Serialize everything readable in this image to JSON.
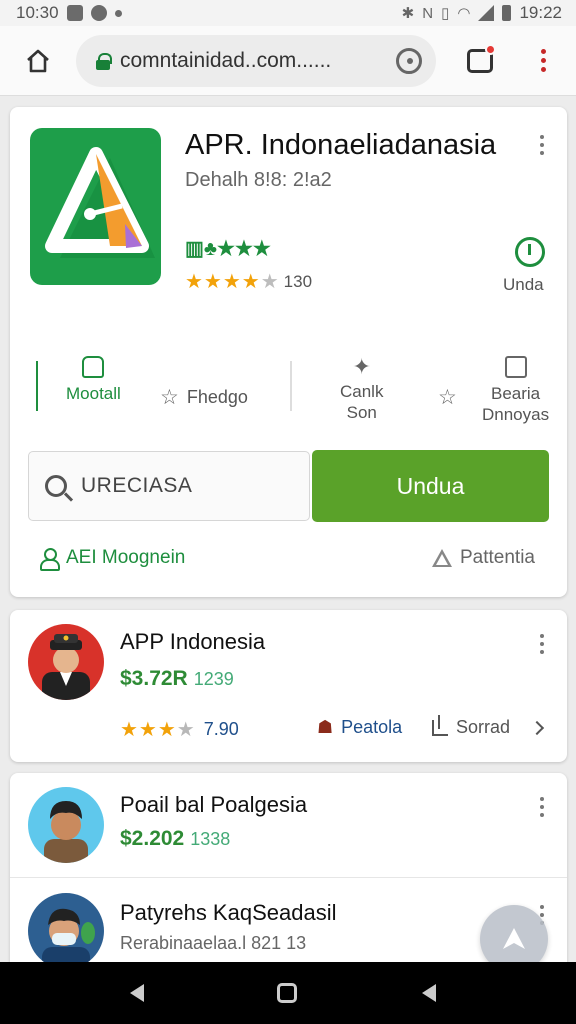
{
  "status_bar": {
    "time_left": "10:30",
    "time_right": "19:22"
  },
  "browser": {
    "url": "comntainidad..com......"
  },
  "hero": {
    "title": "APR. Indonaeliadanasia",
    "developer": "Dehalh 8!8: 2!a2",
    "badge_text": "▥♣★★★",
    "stars": 4.5,
    "rating_count": "130",
    "install_label": "Unda",
    "actions": [
      {
        "label": "Mootall"
      },
      {
        "label": "Fhedgo"
      },
      {
        "label": "Canlk\nSon"
      },
      {
        "label": "Bearia\nDnnoyas"
      }
    ],
    "search_text": "URECIASA",
    "primary_button": "Undua",
    "footer_left": "AEI Moognein",
    "footer_right": "Pattentia"
  },
  "list": [
    {
      "title": "APP Indonesia",
      "price": "$3.72R",
      "price_extra": "1239",
      "stars": 3.5,
      "rating": "7.90",
      "link_label": "Peatola",
      "share_label": "Sorrad"
    },
    {
      "title": "Poail bal Poalgesia",
      "price": "$2.202",
      "price_extra": "1338"
    },
    {
      "title": "Patyrehs KaqSeadasil",
      "subtitle": "Rerabinaaelaa.l 821 13"
    }
  ],
  "colors": {
    "brand_green": "#1e8e3e",
    "button_green": "#5aa229",
    "star": "#f2a20a",
    "link_blue": "#1f4f8b"
  },
  "icons": [
    "home-icon",
    "lock-icon",
    "reload-icon",
    "tabs-icon",
    "menu-icon",
    "install-icon",
    "search-icon",
    "person-icon",
    "warning-icon",
    "share-icon",
    "chevron-right-icon",
    "fab-icon"
  ]
}
